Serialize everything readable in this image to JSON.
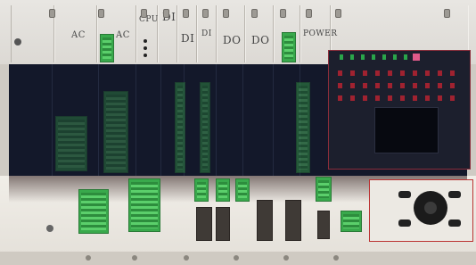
{
  "panel": {
    "labels": [
      {
        "key": "ac1",
        "text": "AC"
      },
      {
        "key": "ac2",
        "text": "AC"
      },
      {
        "key": "cpu",
        "text": "CPU"
      },
      {
        "key": "di1",
        "text": "DI"
      },
      {
        "key": "di2",
        "text": "DI"
      },
      {
        "key": "di3",
        "text": "DI"
      },
      {
        "key": "do1",
        "text": "DO"
      },
      {
        "key": "do2",
        "text": "DO"
      },
      {
        "key": "power",
        "text": "POWER"
      }
    ]
  },
  "colors": {
    "panel": "#e4e1dc",
    "terminal_green": "#39a94c",
    "dark_band": "#13182a",
    "led_red": "#a02230"
  }
}
